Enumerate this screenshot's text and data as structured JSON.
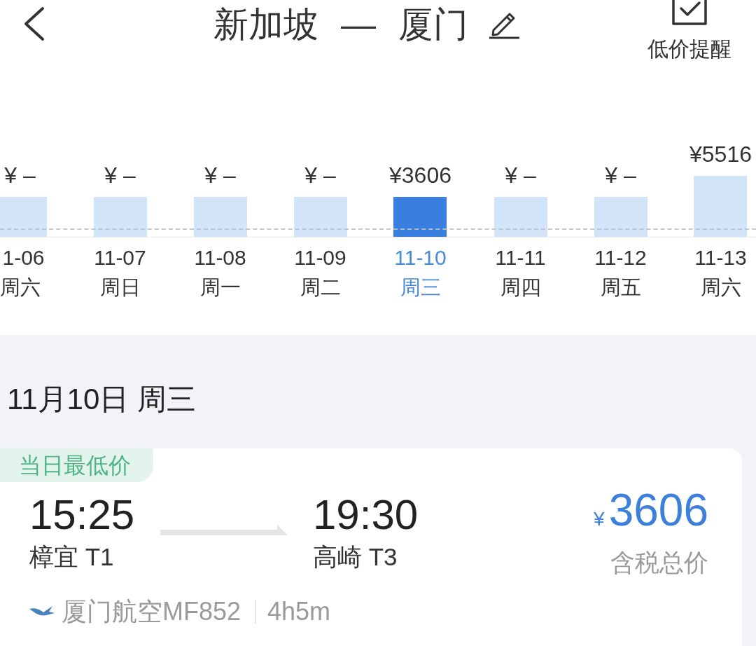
{
  "header": {
    "title": "新加坡 — 厦门",
    "alert_label": "低价提醒"
  },
  "days": [
    {
      "price": "¥ –",
      "date": "1-06",
      "weekday": "周六",
      "level": 0.65,
      "selected": false
    },
    {
      "price": "¥ –",
      "date": "11-07",
      "weekday": "周日",
      "level": 0.65,
      "selected": false
    },
    {
      "price": "¥ –",
      "date": "11-08",
      "weekday": "周一",
      "level": 0.65,
      "selected": false
    },
    {
      "price": "¥ –",
      "date": "11-09",
      "weekday": "周二",
      "level": 0.65,
      "selected": false
    },
    {
      "price": "¥3606",
      "date": "11-10",
      "weekday": "周三",
      "level": 0.65,
      "selected": true
    },
    {
      "price": "¥ –",
      "date": "11-11",
      "weekday": "周四",
      "level": 0.65,
      "selected": false
    },
    {
      "price": "¥ –",
      "date": "11-12",
      "weekday": "周五",
      "level": 0.65,
      "selected": false
    },
    {
      "price": "¥5516",
      "date": "11-13",
      "weekday": "周六",
      "level": 1,
      "selected": false
    }
  ],
  "section": {
    "heading": "11月10日 周三"
  },
  "flight": {
    "tag": "当日最低价",
    "departure": {
      "time": "15:25",
      "airport": "樟宜 T1"
    },
    "arrival": {
      "time": "19:30",
      "airport": "高崎 T3"
    },
    "currency": "¥",
    "price": "3606",
    "price_note": "含税总价",
    "airline": "厦门航空MF852",
    "duration": "4h5m"
  }
}
